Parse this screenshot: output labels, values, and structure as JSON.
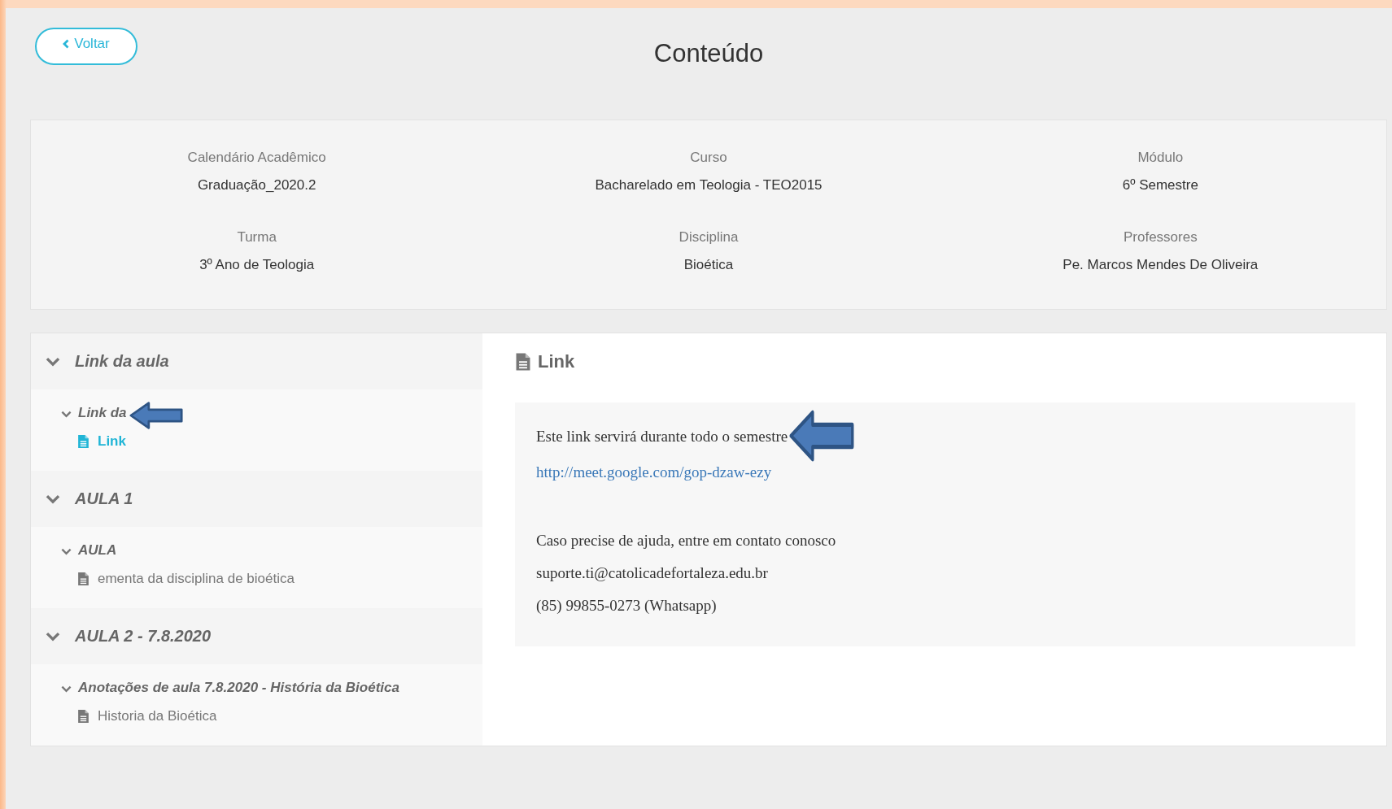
{
  "back_button": {
    "label": "Voltar"
  },
  "title": "Conteúdo",
  "info": [
    {
      "label": "Calendário Acadêmico",
      "value": "Graduação_2020.2"
    },
    {
      "label": "Curso",
      "value": "Bacharelado em Teologia - TEO2015"
    },
    {
      "label": "Módulo",
      "value": "6º Semestre"
    },
    {
      "label": "Turma",
      "value": "3º Ano de Teologia"
    },
    {
      "label": "Disciplina",
      "value": "Bioética"
    },
    {
      "label": "Professores",
      "value": "Pe. Marcos Mendes De Oliveira"
    }
  ],
  "sidebar": {
    "groups": [
      {
        "title": "Link da aula",
        "expanded": true,
        "children": [
          {
            "title": "Link da",
            "expanded": true,
            "annotated": true,
            "children": [
              {
                "label": "Link",
                "selected": true
              }
            ]
          }
        ]
      },
      {
        "title": "AULA 1",
        "expanded": true,
        "children": [
          {
            "title": "AULA",
            "expanded": true,
            "annotated": false,
            "children": [
              {
                "label": "ementa da disciplina de bioética",
                "selected": false
              }
            ]
          }
        ]
      },
      {
        "title": "AULA 2 - 7.8.2020",
        "expanded": true,
        "children": [
          {
            "title": "Anotações de aula 7.8.2020 - História da Bioética",
            "expanded": true,
            "annotated": false,
            "children": [
              {
                "label": "Historia da Bioética",
                "selected": false
              }
            ]
          }
        ]
      }
    ]
  },
  "content": {
    "heading": "Link",
    "lines": [
      {
        "kind": "text",
        "text": "Este link servirá durante todo o semestre",
        "annotated": true
      },
      {
        "kind": "link",
        "text": "http://meet.google.com/gop-dzaw-ezy",
        "annotated": false
      },
      {
        "kind": "blank"
      },
      {
        "kind": "text",
        "text": "Caso precise de ajuda, entre em contato conosco",
        "annotated": false
      },
      {
        "kind": "text",
        "text": "suporte.ti@catolicadefortaleza.edu.br",
        "annotated": false
      },
      {
        "kind": "text",
        "text": "(85) 99855-0273 (Whatsapp)",
        "annotated": false
      }
    ]
  }
}
